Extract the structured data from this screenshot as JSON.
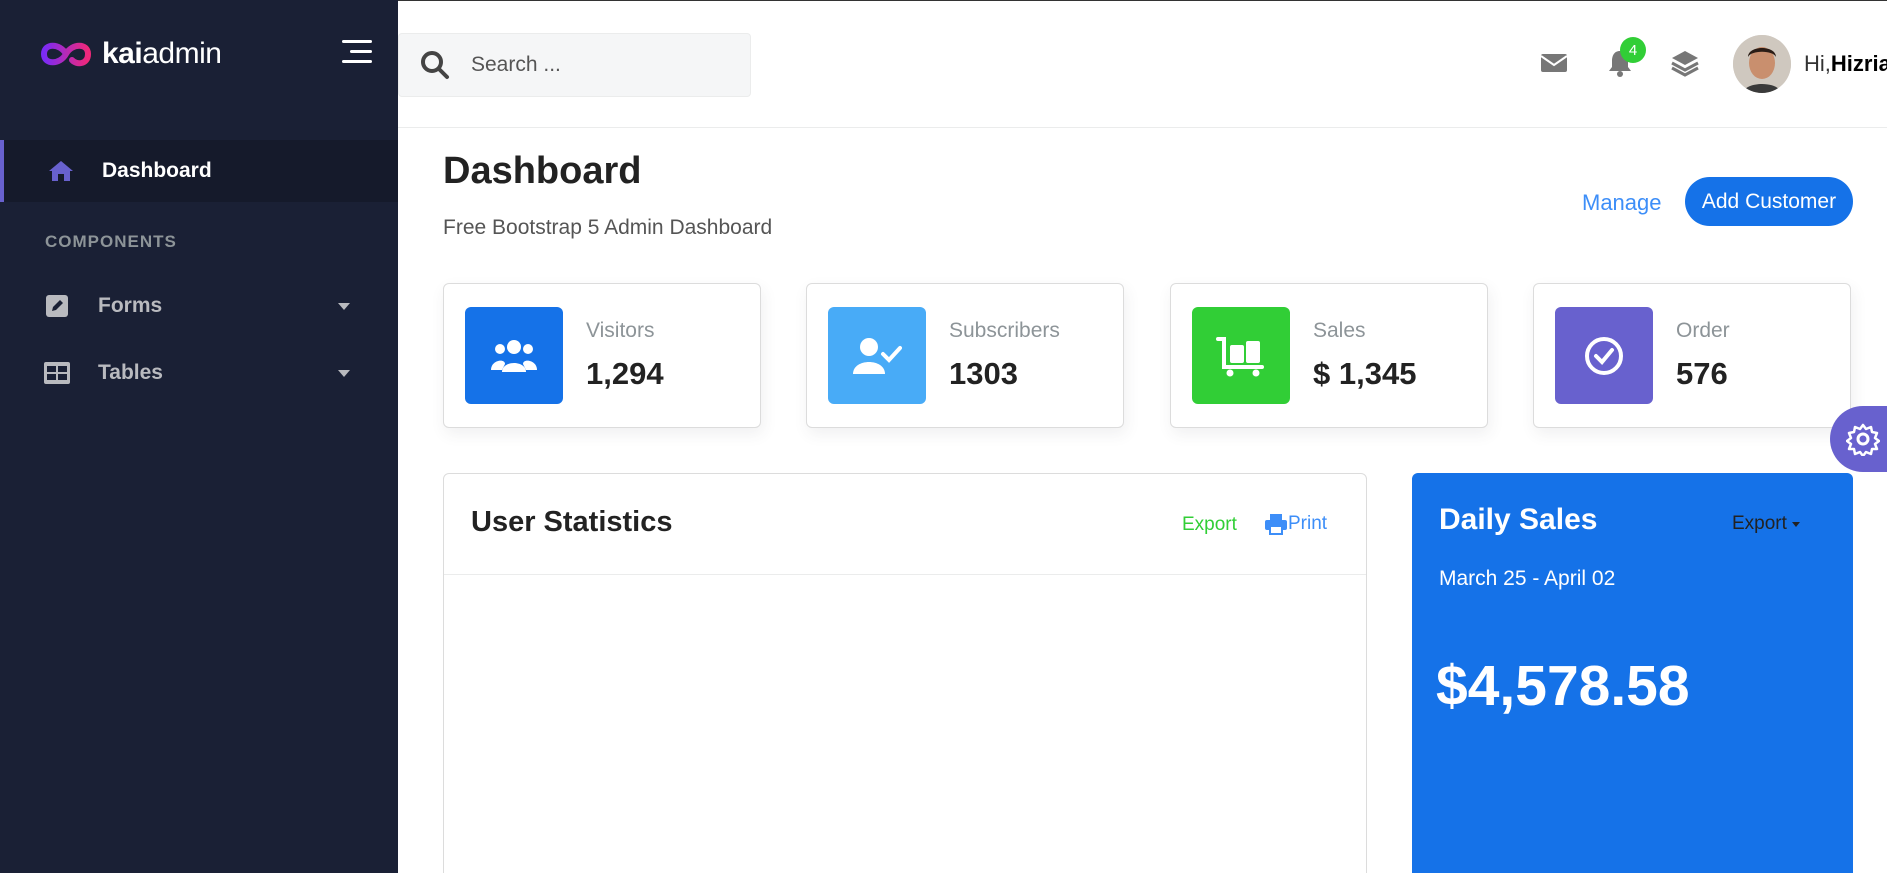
{
  "brand": {
    "name_bold": "kai",
    "name_rest": "admin"
  },
  "sidebar": {
    "active_item": {
      "label": "Dashboard",
      "icon": "home-icon"
    },
    "section_title": "COMPONENTS",
    "items": [
      {
        "label": "Forms",
        "icon": "pen-square-icon"
      },
      {
        "label": "Tables",
        "icon": "table-icon"
      }
    ]
  },
  "header": {
    "search_placeholder": "Search ...",
    "notification_count": "4",
    "greeting_prefix": "Hi,",
    "user_name": "Hizrian"
  },
  "page": {
    "title": "Dashboard",
    "subtitle": "Free Bootstrap 5 Admin Dashboard",
    "manage_label": "Manage",
    "add_customer_label": "Add Customer"
  },
  "stats": [
    {
      "label": "Visitors",
      "value": "1,294",
      "color": "#1572e8",
      "icon": "users-icon"
    },
    {
      "label": "Subscribers",
      "value": "1303",
      "color": "#48abf7",
      "icon": "user-check-icon"
    },
    {
      "label": "Sales",
      "value": "$ 1,345",
      "color": "#31ce36",
      "icon": "luggage-cart-icon"
    },
    {
      "label": "Order",
      "value": "576",
      "color": "#6861ce",
      "icon": "check-circle-icon"
    }
  ],
  "user_statistics": {
    "title": "User Statistics",
    "export_label": "Export",
    "print_label": "Print"
  },
  "daily_sales": {
    "title": "Daily Sales",
    "export_label": "Export",
    "date_range": "March 25 - April 02",
    "amount": "$4,578.58"
  },
  "colors": {
    "sidebar": "#1a2035",
    "primary": "#1572e8",
    "secondary": "#6861ce",
    "success": "#31ce36",
    "info": "#48abf7"
  }
}
